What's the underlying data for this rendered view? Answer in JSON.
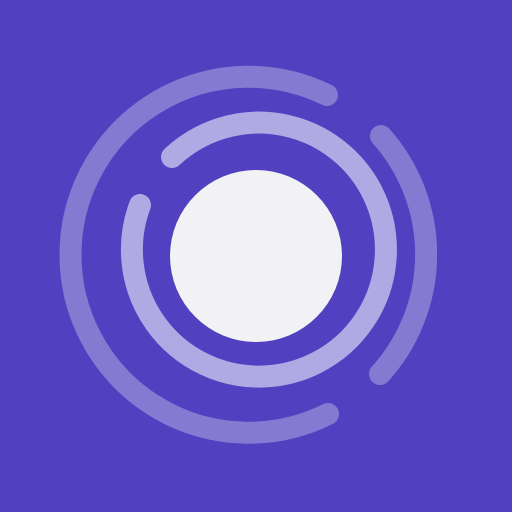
{
  "icon": {
    "name": "radar-rings-icon",
    "colors": {
      "background": "#5140C0",
      "outer_ring": "#8679D2",
      "inner_ring": "#B1A9E3",
      "core": "#F2F2F4"
    }
  }
}
